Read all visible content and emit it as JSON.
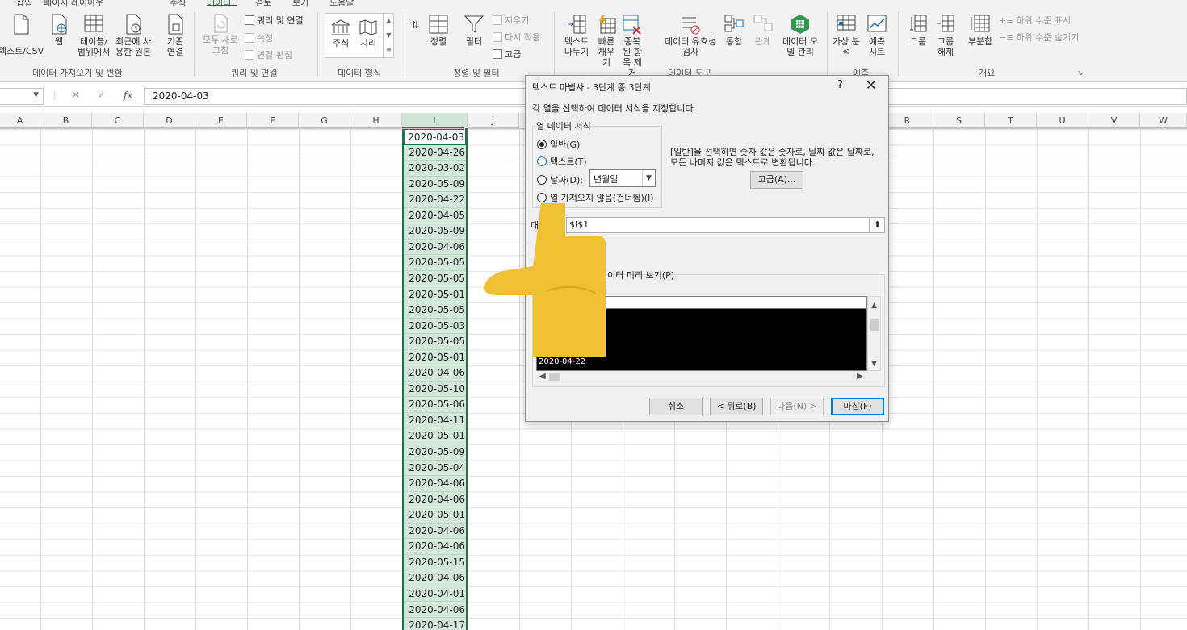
{
  "ribbon_tabs": {
    "items": [
      "삽입",
      "페이지 레이아웃",
      "수식",
      "데이터",
      "검토",
      "보기",
      "도움말"
    ],
    "active": "데이터"
  },
  "ribbon": {
    "get_data": {
      "text_csv": "텍스트/CSV",
      "web": "웹",
      "table_range": "테이블/범위에서",
      "recent_sources": "최근에 사용한 원본",
      "existing": "기존 연결",
      "label": "데이터 가져오기 및 변환"
    },
    "queries": {
      "refresh_all": "모두 새로 고침",
      "queries_connections": "쿼리 및 연결",
      "properties": "속성",
      "edit_links": "연결 편집",
      "label": "쿼리 및 연결"
    },
    "data_types": {
      "stocks": "주식",
      "geography": "지리",
      "label": "데이터 형식"
    },
    "sort_filter": {
      "sort": "정렬",
      "filter": "필터",
      "clear": "지우기",
      "reapply": "다시 적용",
      "advanced": "고급",
      "label": "정렬 및 필터"
    },
    "data_tools": {
      "text_to_columns": "텍스트 나누기",
      "flash_fill": "빠른 채우기",
      "remove_dup": "중복된 항목 제거",
      "validation": "데이터 유효성 검사",
      "consolidate": "통합",
      "relationships": "관계",
      "data_model": "데이터 모델 관리",
      "label": "데이터 도구"
    },
    "forecast": {
      "what_if": "가상 분석",
      "forecast_sheet": "예측 시트",
      "label": "예측"
    },
    "outline": {
      "group": "그룹",
      "ungroup": "그룹 해제",
      "subtotal": "부분합",
      "show_detail": "하위 수준 표시",
      "hide_detail": "하위 수준 숨기기",
      "label": "개요"
    }
  },
  "formula_bar": {
    "fx": "fx",
    "value": "2020-04-03"
  },
  "columns": [
    "A",
    "B",
    "C",
    "D",
    "E",
    "F",
    "G",
    "H",
    "I",
    "J",
    "K",
    "L",
    "M",
    "N",
    "O",
    "P",
    "Q",
    "R",
    "S",
    "T",
    "U",
    "V",
    "W"
  ],
  "selected_column": "I",
  "column_i_values": [
    "2020-04-03",
    "2020-04-26",
    "2020-03-02",
    "2020-05-09",
    "2020-04-22",
    "2020-04-05",
    "2020-05-09",
    "2020-04-06",
    "2020-05-05",
    "2020-05-05",
    "2020-05-01",
    "2020-05-05",
    "2020-05-03",
    "2020-05-05",
    "2020-05-01",
    "2020-04-06",
    "2020-05-10",
    "2020-05-06",
    "2020-04-11",
    "2020-05-01",
    "2020-05-09",
    "2020-05-04",
    "2020-04-06",
    "2020-04-06",
    "2020-05-01",
    "2020-04-06",
    "2020-04-06",
    "2020-05-15",
    "2020-04-06",
    "2020-04-01",
    "2020-04-06",
    "2020-04-17"
  ],
  "dialog": {
    "title": "텍스트 마법사 - 3단계 중 3단계",
    "help": "?",
    "close": "✕",
    "instruction": "각 열을 선택하여 데이터 서식을 지정합니다.",
    "group_label": "열 데이터 서식",
    "options": [
      {
        "label": "일반(G)",
        "selected": true
      },
      {
        "label": "텍스트(T)",
        "selected": false
      },
      {
        "label": "날짜(D):",
        "selected": false
      },
      {
        "label": "열 가져오지 않음(건너뜀)(I)",
        "selected": false
      }
    ],
    "date_format": "년월일",
    "description": "[일반]을 선택하면 숫자 값은 숫자로, 날짜 값은 날짜로, 모든 나머지 값은 텍스트로 변환됩니다.",
    "advanced_button": "고급(A)...",
    "destination_label": "대상:",
    "destination_value": "$I$1",
    "preview_label": "데이터 미리 보기(P)",
    "preview_header": "일반",
    "preview_rows": [
      "2020-04-03",
      "2020-04-26",
      "2020-03-02",
      "2020-05-09",
      "2020-04-22"
    ],
    "buttons": {
      "cancel": "취소",
      "back": "< 뒤로(B)",
      "next": "다음(N) >",
      "finish": "마침(F)"
    }
  },
  "colors": {
    "excel_green": "#217346",
    "selection_fill": "#d4e7db",
    "overlay_hand": "#f0c233"
  }
}
